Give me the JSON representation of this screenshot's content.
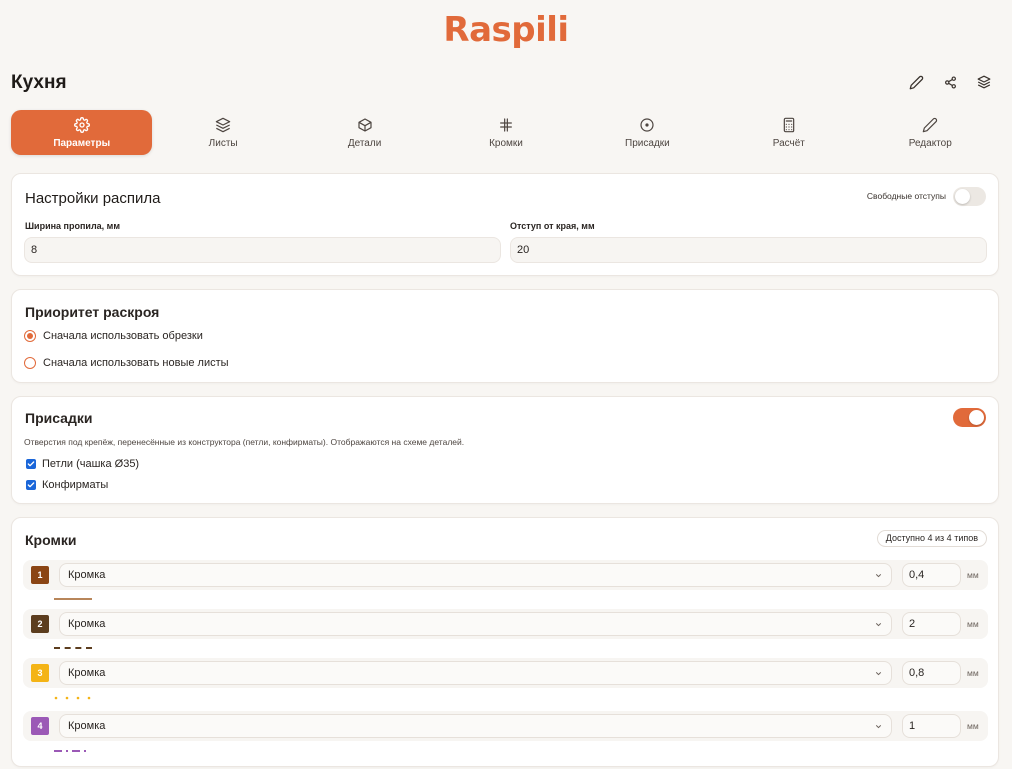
{
  "brand": {
    "logo_text": "Raspili",
    "accent": "#e16a3a"
  },
  "project": {
    "title": "Кухня"
  },
  "top_actions": [
    {
      "name": "edit-icon",
      "icon": "pencil"
    },
    {
      "name": "share-icon",
      "icon": "share"
    },
    {
      "name": "layers-icon",
      "icon": "layers"
    }
  ],
  "tabs": [
    {
      "label": "Параметры",
      "icon": "gear",
      "active": true
    },
    {
      "label": "Листы",
      "icon": "layers"
    },
    {
      "label": "Детали",
      "icon": "cube"
    },
    {
      "label": "Кромки",
      "icon": "hash"
    },
    {
      "label": "Присадки",
      "icon": "target"
    },
    {
      "label": "Расчёт",
      "icon": "calculator"
    },
    {
      "label": "Редактор",
      "icon": "pencil"
    }
  ],
  "saw_settings": {
    "title": "Настройки распила",
    "free_margins_label": "Свободные отступы",
    "free_margins_on": false,
    "kerf_label": "Ширина пропила, мм",
    "kerf_value": "8",
    "edge_offset_label": "Отступ от края, мм",
    "edge_offset_value": "20"
  },
  "cut_priority": {
    "title": "Приоритет раскроя",
    "options": [
      {
        "label": "Сначала использовать обрезки",
        "selected": true
      },
      {
        "label": "Сначала использовать новые листы",
        "selected": false
      }
    ]
  },
  "drilling": {
    "title": "Присадки",
    "enabled": true,
    "description": "Отверстия под крепёж, перенесённые из конструктора (петли, конфирматы). Отображаются на схеме деталей.",
    "items": [
      {
        "label": "Петли (чашка Ø35)",
        "checked": true
      },
      {
        "label": "Конфирматы",
        "checked": true
      }
    ]
  },
  "edges": {
    "title": "Кромки",
    "availability_badge": "Доступно 4 из 4 типов",
    "unit": "мм",
    "items": [
      {
        "num": "1",
        "color": "#8b4513",
        "type": "Кромка",
        "thickness": "0,4",
        "line_style": "solid"
      },
      {
        "num": "2",
        "color": "#5c3d1e",
        "type": "Кромка",
        "thickness": "2",
        "line_style": "dashed"
      },
      {
        "num": "3",
        "color": "#f4b416",
        "type": "Кромка",
        "thickness": "0,8",
        "line_style": "dotted"
      },
      {
        "num": "4",
        "color": "#9b59b6",
        "type": "Кромка",
        "thickness": "1",
        "line_style": "dashdot"
      }
    ]
  }
}
